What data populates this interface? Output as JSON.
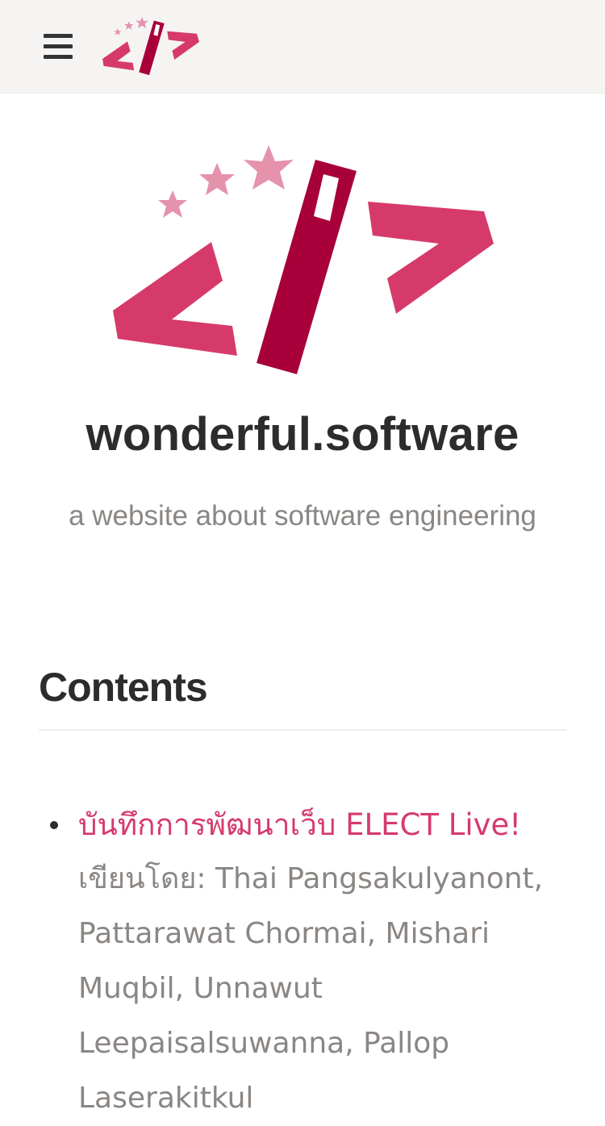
{
  "colors": {
    "brand_pink": "#d63a6b",
    "brand_crimson": "#a8003a",
    "star_pink": "#e593ad",
    "topbar_bg": "#f5f4f3",
    "text_dark": "#2c2c2c",
    "text_muted": "#8a8683"
  },
  "header": {
    "menu_icon": "hamburger-menu-icon",
    "logo_icon": "magic-wand-code-logo"
  },
  "hero": {
    "logo_icon": "magic-wand-code-logo",
    "title": "wonderful.software",
    "tagline": "a website about software engineering"
  },
  "contents": {
    "heading": "Contents",
    "items": [
      {
        "title": "บันทึกการพัฒนาเว็บ ELECT Live!",
        "meta": "เขียนโดย: Thai Pangsakulyanont, Pattarawat Chormai, Mishari Muqbil, Unnawut Leepaisalsuwanna, Pallop Laserakitkul"
      }
    ]
  }
}
